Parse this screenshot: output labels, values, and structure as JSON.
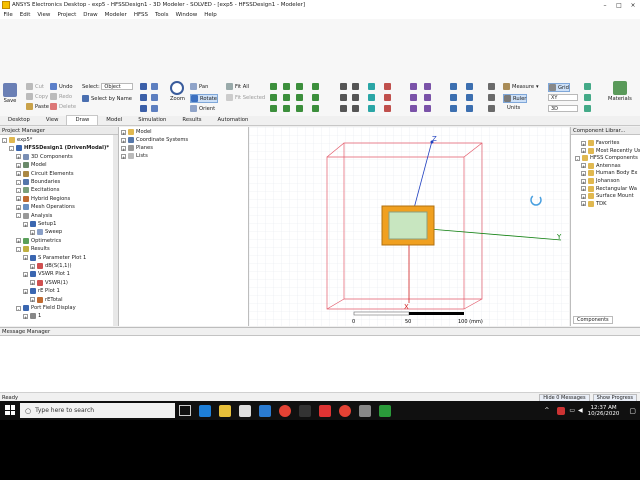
{
  "window": {
    "title": "ANSYS Electronics Desktop - exp5 - HFSSDesign1 - 3D Modeler - SOLVED - [exp5 - HFSSDesign1 - Modeler]"
  },
  "menu": [
    "File",
    "Edit",
    "View",
    "Project",
    "Draw",
    "Modeler",
    "HFSS",
    "Tools",
    "Window",
    "Help"
  ],
  "ribbon": {
    "save": "Save",
    "cut": "Cut",
    "copy": "Copy",
    "paste": "Paste",
    "undo": "Undo",
    "redo": "Redo",
    "delete": "Delete",
    "select_label": "Select:",
    "select_value": "Object",
    "select_by_name": "Select by Name",
    "zoom": "Zoom",
    "pan": "Pan",
    "rotate": "Rotate",
    "orient": "Orient",
    "fit_all": "Fit All",
    "fit_selected": "Fit Selected",
    "measure": "Measure",
    "ruler": "Ruler",
    "units": "Units",
    "grid": "Grid",
    "plane_value": "XY",
    "dim_value": "3D",
    "materials": "Materials"
  },
  "ribbon_tabs": [
    "Desktop",
    "View",
    "Draw",
    "Model",
    "Simulation",
    "Results",
    "Automation"
  ],
  "ribbon_active_tab": "Draw",
  "project_manager": {
    "title": "Project Manager",
    "items": [
      {
        "label": "exp5*",
        "level": 0
      },
      {
        "label": "HFSSDesign1 (DrivenModal)*",
        "level": 1
      },
      {
        "label": "3D Components",
        "level": 2
      },
      {
        "label": "Model",
        "level": 2
      },
      {
        "label": "Circuit Elements",
        "level": 2
      },
      {
        "label": "Boundaries",
        "level": 2
      },
      {
        "label": "Excitations",
        "level": 2
      },
      {
        "label": "Hybrid Regions",
        "level": 2
      },
      {
        "label": "Mesh Operations",
        "level": 2
      },
      {
        "label": "Analysis",
        "level": 2
      },
      {
        "label": "Setup1",
        "level": 3
      },
      {
        "label": "Sweep",
        "level": 4
      },
      {
        "label": "Optimetrics",
        "level": 2
      },
      {
        "label": "Results",
        "level": 2
      },
      {
        "label": "S Parameter Plot 1",
        "level": 3
      },
      {
        "label": "dB(S(1,1))",
        "level": 4
      },
      {
        "label": "VSWR Plot 1",
        "level": 3
      },
      {
        "label": "VSWR(1)",
        "level": 4
      },
      {
        "label": "rE Plot 1",
        "level": 3
      },
      {
        "label": "rETotal",
        "level": 4
      },
      {
        "label": "Port Field Display",
        "level": 2
      },
      {
        "label": "1",
        "level": 3
      }
    ]
  },
  "model_tree": {
    "items": [
      "Model",
      "Coordinate Systems",
      "Planes",
      "Lists"
    ]
  },
  "viewport": {
    "axis_z": "Z",
    "axis_y": "Y",
    "axis_x": "X",
    "scale_labels": [
      "0",
      "50",
      "100 (mm)"
    ]
  },
  "component_library": {
    "title": "Component Librar...",
    "items": [
      {
        "label": "Favorites",
        "level": 1
      },
      {
        "label": "Most Recently Use",
        "level": 1
      },
      {
        "label": "HFSS Components",
        "level": 0
      },
      {
        "label": "Antennas",
        "level": 1
      },
      {
        "label": "Human Body Ex",
        "level": 1
      },
      {
        "label": "Johanson",
        "level": 1
      },
      {
        "label": "Rectangular Wa",
        "level": 1
      },
      {
        "label": "Surface Mount",
        "level": 1
      },
      {
        "label": "TDK",
        "level": 1
      }
    ],
    "tab": "Components"
  },
  "message_manager": {
    "title": "Message Manager"
  },
  "status": {
    "text": "Ready",
    "hide_messages": "Hide 0 Messages",
    "show_progress": "Show Progress"
  },
  "taskbar": {
    "search_placeholder": "Type here to search",
    "time": "12:37 AM",
    "date": "10/26/2020"
  },
  "colors": {
    "box_outline": "#e35a6a",
    "substrate": "#f0a020",
    "patch": "#c8e6c0",
    "z_axis": "#2040c0",
    "y_axis": "#108010",
    "x_axis": "#d02020"
  }
}
